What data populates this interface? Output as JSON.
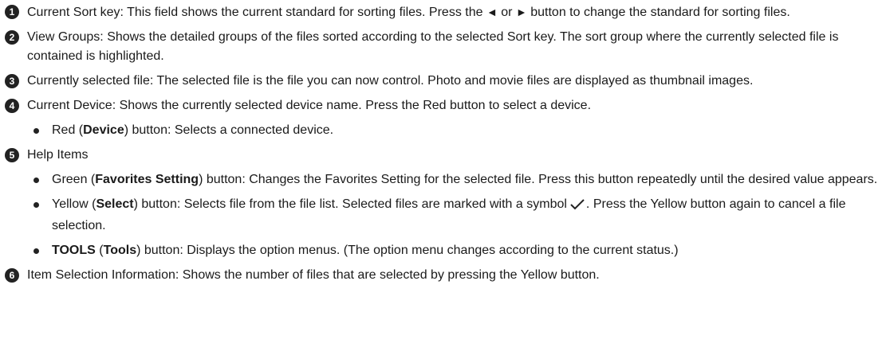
{
  "items": [
    {
      "number": "1",
      "text_a": "Current Sort key: This field shows the current standard for sorting files. Press the ",
      "left_arrow": "◄",
      "text_b": " or ",
      "right_arrow": "►",
      "text_c": " button to change the standard for sorting files."
    },
    {
      "number": "2",
      "text": "View Groups: Shows the detailed groups of the files sorted according to the selected Sort key. The sort group where the currently selected file is contained is highlighted."
    },
    {
      "number": "3",
      "text": "Currently selected file: The selected file is the file you can now control. Photo and movie files are displayed as thumbnail images."
    },
    {
      "number": "4",
      "text": "Current Device: Shows the currently selected device name. Press the Red button to select a device.",
      "bullets": [
        {
          "pre": "Red (",
          "bold": "Device",
          "post": ") button: Selects a connected device."
        }
      ]
    },
    {
      "number": "5",
      "text": "Help Items",
      "bullets": [
        {
          "pre": "Green (",
          "bold": "Favorites Setting",
          "post": ") button: Changes the Favorites Setting for the selected file. Press this button repeatedly until the desired value appears."
        },
        {
          "pre": "Yellow (",
          "bold": "Select",
          "post_a": ") button: Selects file from the file list. Selected files are marked with a symbol",
          "check_icon": "check-icon",
          "post_b": ". Press the Yellow button again to cancel a file selection."
        },
        {
          "bold_a": "TOOLS",
          "mid": " (",
          "bold": "Tools",
          "post": ") button: Displays the option menus. (The option menu changes according to the current status.)"
        }
      ]
    },
    {
      "number": "6",
      "text": "Item Selection Information: Shows the number of files that are selected by pressing the Yellow button."
    }
  ]
}
